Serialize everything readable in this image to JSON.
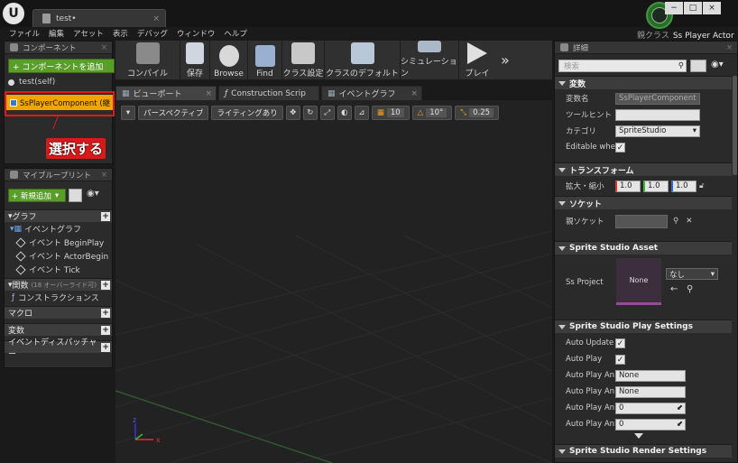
{
  "titlebar": {
    "doc_tab": "test•",
    "parent_class_label": "親クラス",
    "parent_class_value": "Ss Player Actor",
    "logo": "U"
  },
  "menu": [
    "ファイル",
    "編集",
    "アセット",
    "表示",
    "デバッグ",
    "ウィンドウ",
    "ヘルプ"
  ],
  "components": {
    "title": "コンポーネント",
    "add_button": "+ コンポーネントを追加",
    "self_item": "test(self)",
    "selected_item": "SsPlayerComponent (継",
    "annotation": "選択する"
  },
  "my_blueprint": {
    "title": "マイブループリント",
    "new_add": "+ 新規追加",
    "sections": [
      {
        "label": "グラフ",
        "items": []
      },
      {
        "label": "イベントグラフ",
        "items": [
          "イベント BeginPlay",
          "イベント ActorBegin",
          "イベント Tick"
        ]
      },
      {
        "label": "関数",
        "extra": "(18 オーバーライド可)",
        "items": [
          "コンストラクションス"
        ]
      },
      {
        "label": "マクロ"
      },
      {
        "label": "変数"
      },
      {
        "label": "イベントディスパッチャー"
      }
    ]
  },
  "toolbar": [
    "コンパイル",
    "保存",
    "Browse",
    "Find",
    "クラス設定",
    "クラスのデフォルト",
    "シミュレーション",
    "プレイ"
  ],
  "viewport_tabs": [
    "ビューポート",
    "Construction Scrip",
    "イベントグラフ"
  ],
  "viewport_bar": {
    "perspective": "パースペクティブ",
    "lighting": "ライティングあり",
    "grid_snap": "10",
    "rot_snap": "10°",
    "scale_snap": "0.25"
  },
  "details": {
    "title": "詳細",
    "search_placeholder": "検索",
    "variables": {
      "header": "変数",
      "name_label": "変数名",
      "name_value": "SsPlayerComponent",
      "tooltip_label": "ツールヒント",
      "category_label": "カテゴリ",
      "category_value": "SpriteStudio",
      "editable_label": "Editable when"
    },
    "transform": {
      "header": "トランスフォーム",
      "scale_label": "拡大・縮小",
      "scale": [
        "1.0",
        "1.0",
        "1.0"
      ]
    },
    "socket": {
      "header": "ソケット",
      "parent_socket_label": "親ソケット"
    },
    "asset": {
      "header": "Sprite Studio Asset",
      "ss_project_label": "Ss Project",
      "thumb": "None",
      "dropdown": "なし"
    },
    "play": {
      "header": "Sprite Studio Play Settings",
      "auto_update": "Auto Update",
      "auto_play": "Auto Play",
      "rows": [
        {
          "label": "Auto Play Anir",
          "value": "None"
        },
        {
          "label": "Auto Play Anir",
          "value": "None"
        },
        {
          "label": "Auto Play Anir",
          "value": "0"
        },
        {
          "label": "Auto Play Anir",
          "value": "0"
        }
      ]
    },
    "render": {
      "header": "Sprite Studio Render Settings"
    }
  }
}
